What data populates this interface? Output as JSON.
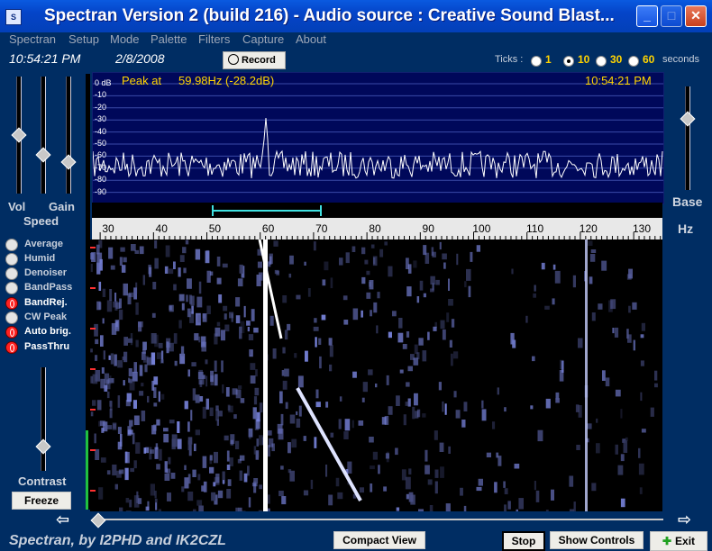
{
  "window": {
    "title": "Spectran Version 2 (build 216) - Audio source  :  Creative Sound Blast...",
    "app_icon": "spectran-app-icon",
    "controls": {
      "minimize": "_",
      "maximize": "□",
      "close": "✕"
    }
  },
  "menu": [
    "Spectran",
    "Setup",
    "Mode",
    "Palette",
    "Filters",
    "Capture",
    "About"
  ],
  "status": {
    "time": "10:54:21 PM",
    "date": "2/8/2008",
    "record_label": "Record"
  },
  "ticks": {
    "label": "Ticks :",
    "options": [
      "1",
      "10",
      "30",
      "60"
    ],
    "selected": "10",
    "unit": "seconds"
  },
  "left_panel": {
    "vol_label": "Vol",
    "gain_label": "Gain",
    "speed_label": "Speed",
    "contrast_label": "Contrast",
    "freeze_label": "Freeze",
    "options": [
      {
        "label": "Average",
        "on": false
      },
      {
        "label": "Humid",
        "on": false
      },
      {
        "label": "Denoiser",
        "on": false
      },
      {
        "label": "BandPass",
        "on": false
      },
      {
        "label": "BandRej.",
        "on": true
      },
      {
        "label": "CW Peak",
        "on": false
      },
      {
        "label": "Auto brig.",
        "on": true
      },
      {
        "label": "PassThru",
        "on": true
      }
    ]
  },
  "right_panel": {
    "base_label": "Base",
    "hz_label": "Hz"
  },
  "spectrum": {
    "peak_label": "Peak at",
    "peak_value": "59.98Hz (-28.2dB)",
    "time": "10:54:21 PM",
    "db_ticks": [
      "0 dB",
      "-10",
      "-20",
      "-30",
      "-40",
      "-50",
      "-60",
      "-70",
      "-80",
      "-90"
    ],
    "freq_ticks": [
      "30",
      "40",
      "50",
      "60",
      "70",
      "80",
      "90",
      "100",
      "110",
      "120",
      "130"
    ]
  },
  "bottom": {
    "credit": "Spectran, by I2PHD and IK2CZL",
    "compact_view": "Compact View",
    "stop": "Stop",
    "show_controls": "Show Controls",
    "exit": "Exit"
  },
  "colors": {
    "background": "#002d63",
    "spectrum_bg": "#00085a",
    "accent_yellow": "#ffd400",
    "titlebar": "#0444c8"
  }
}
